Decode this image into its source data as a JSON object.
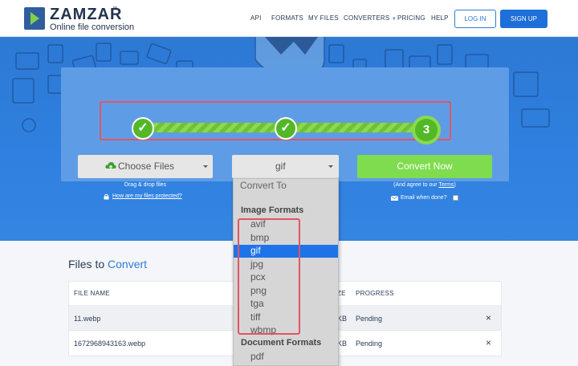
{
  "header": {
    "brand": "ZAMZAR",
    "brand_tm": "™",
    "tagline": "Online file conversion",
    "nav": [
      {
        "label": "API"
      },
      {
        "label": "FORMATS"
      },
      {
        "label": "MY FILES"
      },
      {
        "label": "CONVERTERS"
      },
      {
        "label": "PRICING"
      },
      {
        "label": "HELP"
      }
    ],
    "login": "LOG IN",
    "signup": "SIGN UP"
  },
  "progress": {
    "step1": "✓",
    "step2": "✓",
    "step3": "3"
  },
  "choose": {
    "label": "Choose Files",
    "drag": "Drag & drop files",
    "protect": "How are my files protected?"
  },
  "format": {
    "selected": "gif"
  },
  "convert": {
    "label": "Convert Now",
    "agree_prefix": "(And agree to our ",
    "agree_terms": "Terms",
    "agree_suffix": ")",
    "email": "Email when done?"
  },
  "dropdown": {
    "first": "Convert To",
    "image_header": "Image Formats",
    "image_formats": [
      "avif",
      "bmp",
      "gif",
      "jpg",
      "pcx",
      "png",
      "tga",
      "tiff",
      "wbmp"
    ],
    "document_header": "Document Formats",
    "document_formats": [
      "pdf"
    ]
  },
  "files": {
    "title_prefix": "Files to ",
    "title_accent": "Convert",
    "columns": {
      "name": "FILE NAME",
      "size": "ZE",
      "progress": "PROGRESS"
    },
    "rows": [
      {
        "name": "11.webp",
        "size": "KB",
        "status": "Pending",
        "remove": "×"
      },
      {
        "name": "1672968943163.webp",
        "size": "KB",
        "status": "Pending",
        "remove": "×"
      }
    ]
  },
  "colors": {
    "brand_blue": "#2f7bd8",
    "hero_blue": "#2f80e0",
    "progress_green": "#53b827",
    "convert_green": "#7fdc4f",
    "highlight_red": "#e05565",
    "selected_blue": "#1e73e8"
  }
}
